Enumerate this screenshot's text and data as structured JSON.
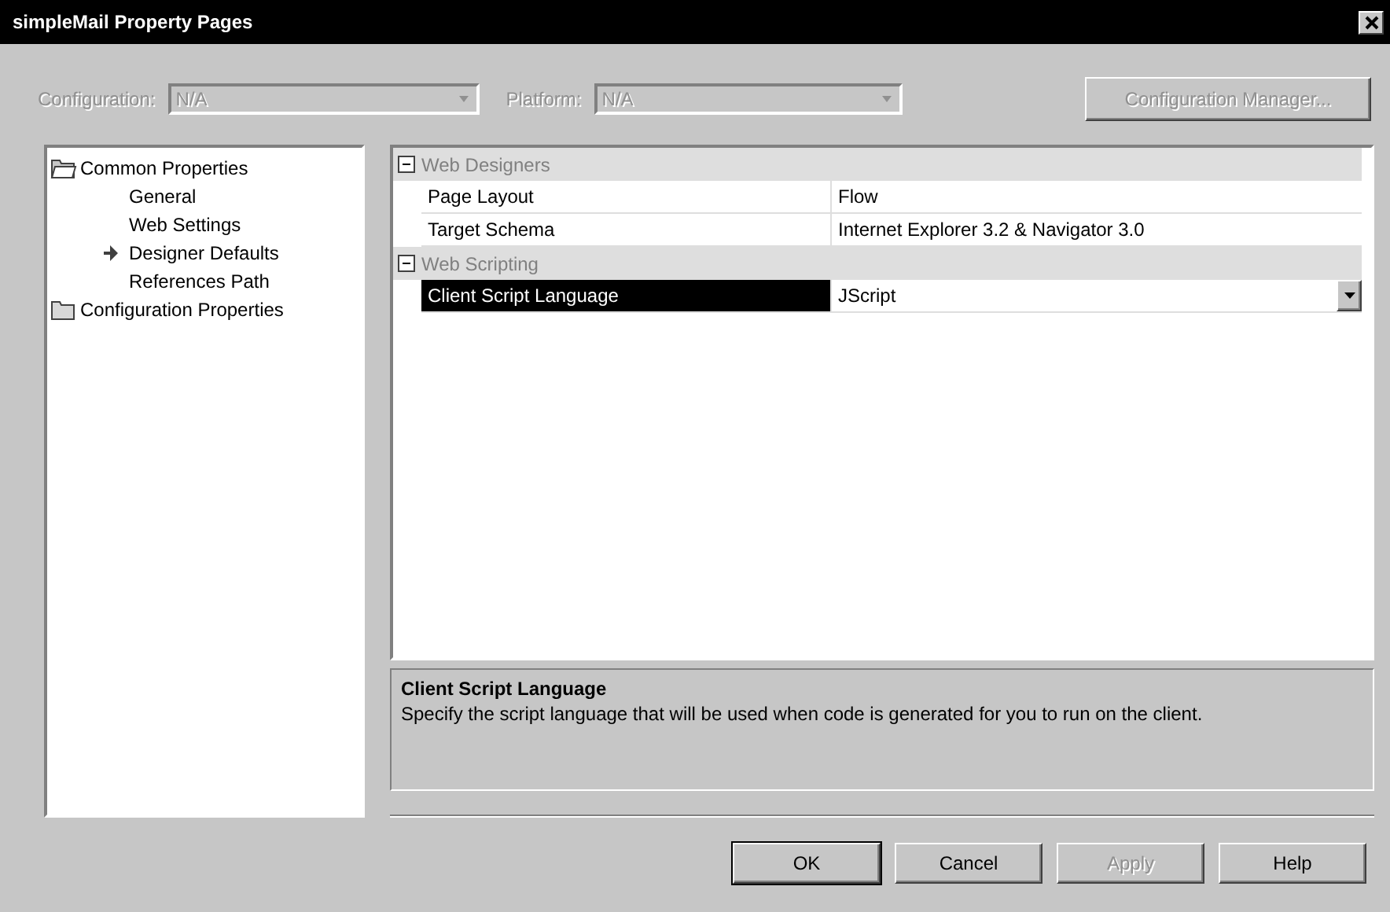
{
  "window": {
    "title": "simpleMail Property Pages"
  },
  "toolbar": {
    "configuration": {
      "label": "Configuration:",
      "value": "N/A",
      "disabled": true
    },
    "platform": {
      "label": "Platform:",
      "value": "N/A",
      "disabled": true
    },
    "manager_button": {
      "label": "Configuration Manager...",
      "disabled": true
    }
  },
  "tree": [
    {
      "label": "Common Properties",
      "expanded": true,
      "selected": false,
      "children": [
        {
          "label": "General",
          "selected": false
        },
        {
          "label": "Web Settings",
          "selected": false
        },
        {
          "label": "Designer Defaults",
          "selected": true
        },
        {
          "label": "References Path",
          "selected": false
        }
      ]
    },
    {
      "label": "Configuration Properties",
      "expanded": false,
      "selected": false
    }
  ],
  "grid": [
    {
      "category": "Web Designers",
      "expanded": true,
      "rows": [
        {
          "name": "Page Layout",
          "value": "Flow",
          "selected": false
        },
        {
          "name": "Target Schema",
          "value": "Internet Explorer 3.2 & Navigator 3.0",
          "selected": false
        }
      ]
    },
    {
      "category": "Web Scripting",
      "expanded": true,
      "rows": [
        {
          "name": "Client Script Language",
          "value": "JScript",
          "selected": true
        }
      ]
    }
  ],
  "description": {
    "title": "Client Script Language",
    "text": "Specify the script language that will be used when code is generated for you to run on the client."
  },
  "buttons": [
    {
      "label": "OK",
      "default": true,
      "disabled": false
    },
    {
      "label": "Cancel",
      "default": false,
      "disabled": false
    },
    {
      "label": "Apply",
      "default": false,
      "disabled": true
    },
    {
      "label": "Help",
      "default": false,
      "disabled": false
    }
  ]
}
